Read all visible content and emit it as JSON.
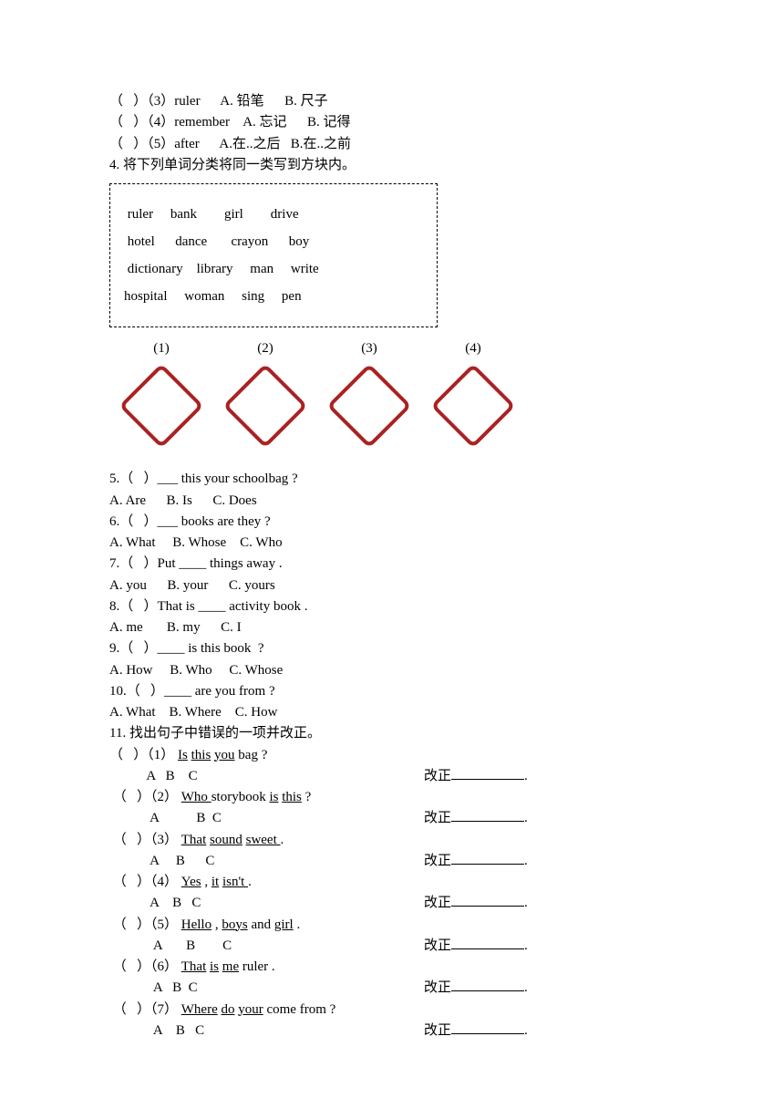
{
  "q3": {
    "line": "（   ）（3）ruler      A. 铅笔      B. 尺子"
  },
  "q3b": {
    "line": "（   ）（4）remember    A. 忘记      B. 记得"
  },
  "q3c": {
    "line": "（   ）（5）after      A.在..之后   B.在..之前"
  },
  "q4": {
    "stem": "4. 将下列单词分类将同一类写到方块内。",
    "rows": [
      " ruler     bank        girl        drive",
      " hotel      dance       crayon      boy",
      " dictionary    library     man     write",
      "hospital     woman     sing     pen"
    ],
    "labels": [
      "(1)",
      "(2)",
      "(3)",
      "(4)"
    ]
  },
  "q5": {
    "stem": "5.（   ）___ this your schoolbag ?",
    "opt": "A. Are      B. Is      C. Does"
  },
  "q6": {
    "stem": "6.（   ）___ books are they ?",
    "opt": "A. What     B. Whose    C. Who"
  },
  "q7": {
    "stem": "7.（   ）Put ____ things away .",
    "opt": "A. you      B. your      C. yours"
  },
  "q8": {
    "stem": "8.（   ）That is ____ activity book .",
    "opt": "A. me       B. my      C. I"
  },
  "q9": {
    "stem": "9.（   ）____ is this book  ?",
    "opt": "A. How     B. Who     C. Whose"
  },
  "q10": {
    "stem": "10.（   ）____ are you from ?",
    "opt": "A. What    B. Where    C. How"
  },
  "q11": {
    "stem": "11. 找出句子中错误的一项并改正。",
    "corrLabel": "改正",
    "items": [
      {
        "prefix": "（   ）（1） ",
        "segs": [
          "Is",
          " ",
          "this",
          " ",
          "you",
          " bag ?"
        ],
        "u": [
          true,
          false,
          true,
          false,
          true,
          false
        ],
        "idx": "           A   B    C"
      },
      {
        "prefix": " （   ）（2） ",
        "segs": [
          "Who ",
          "storybook ",
          "is",
          " ",
          "this",
          " ?"
        ],
        "u": [
          true,
          false,
          true,
          false,
          true,
          false
        ],
        "idx": "            A           B  C"
      },
      {
        "prefix": " （   ）（3） ",
        "segs": [
          "That",
          " ",
          "sound",
          " ",
          "sweet ",
          "."
        ],
        "u": [
          true,
          false,
          true,
          false,
          true,
          false
        ],
        "idx": "            A     B      C"
      },
      {
        "prefix": " （   ）（4） ",
        "segs": [
          "Yes",
          " , ",
          "it",
          " ",
          "isn't ",
          "."
        ],
        "u": [
          true,
          false,
          true,
          false,
          true,
          false
        ],
        "idx": "            A    B   C"
      },
      {
        "prefix": " （   ）（5） ",
        "segs": [
          "Hello",
          " , ",
          "boys",
          " and ",
          "girl",
          " ."
        ],
        "u": [
          true,
          false,
          true,
          false,
          true,
          false
        ],
        "idx": "             A       B        C"
      },
      {
        "prefix": " （   ）（6） ",
        "segs": [
          "That",
          " ",
          "is",
          " ",
          "me",
          " ruler ."
        ],
        "u": [
          true,
          false,
          true,
          false,
          true,
          false
        ],
        "idx": "             A   B  C"
      },
      {
        "prefix": " （   ）（7） ",
        "segs": [
          "Where",
          " ",
          "do",
          " ",
          "your",
          " come from ?"
        ],
        "u": [
          true,
          false,
          true,
          false,
          true,
          false
        ],
        "idx": "             A    B   C"
      }
    ]
  }
}
